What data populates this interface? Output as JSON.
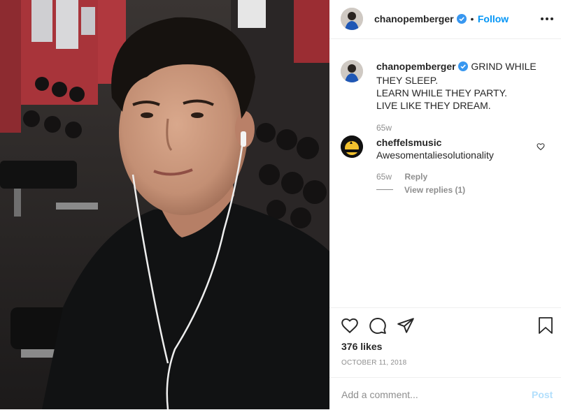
{
  "post": {
    "username": "chanopemberger",
    "dot": "•",
    "follow_label": "Follow",
    "more_icon": "more-horizontal-icon",
    "caption_lines": [
      "GRIND WHILE",
      "THEY SLEEP.",
      "LEARN WHILE THEY PARTY.",
      "LIVE LIKE THEY DREAM."
    ],
    "caption_age": "65w"
  },
  "comment": {
    "username": "cheffelsmusic",
    "text": "Awesomentaliesolutionality",
    "age": "65w",
    "reply_label": "Reply",
    "view_replies": "View replies (1)"
  },
  "actions": {
    "likes": "376 likes",
    "date": "OCTOBER 11, 2018"
  },
  "add_comment": {
    "placeholder": "Add a comment...",
    "post_label": "Post"
  },
  "colors": {
    "link_blue": "#0095f6",
    "verified_blue": "#3897f0",
    "muted": "#8e8e8e",
    "post_disabled": "#b2dffc"
  }
}
